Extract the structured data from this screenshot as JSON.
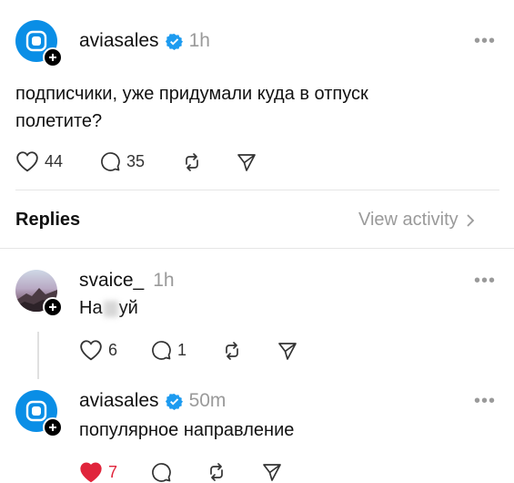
{
  "post": {
    "username": "aviasales",
    "time": "1h",
    "text_line1": "подписчики, уже придумали куда в отпуск",
    "text_line2": "полетите?",
    "likes": "44",
    "comments": "35"
  },
  "replies_header": {
    "label": "Replies",
    "view_activity": "View activity"
  },
  "reply1": {
    "username": "svaice_",
    "time": "1h",
    "text_start": "На",
    "text_end": "уй",
    "likes": "6",
    "comments": "1"
  },
  "reply2": {
    "username": "aviasales",
    "time": "50m",
    "text": "популярное направление",
    "likes": "7",
    "like_color": "#e0243b"
  },
  "icons": [
    "heart-icon",
    "comment-icon",
    "repost-icon",
    "share-icon",
    "verified-icon",
    "plus-icon",
    "more-icon",
    "chevron-right-icon"
  ],
  "colors": {
    "verified": "#1d9bf0",
    "brand_blue": "#0a8ee6"
  }
}
